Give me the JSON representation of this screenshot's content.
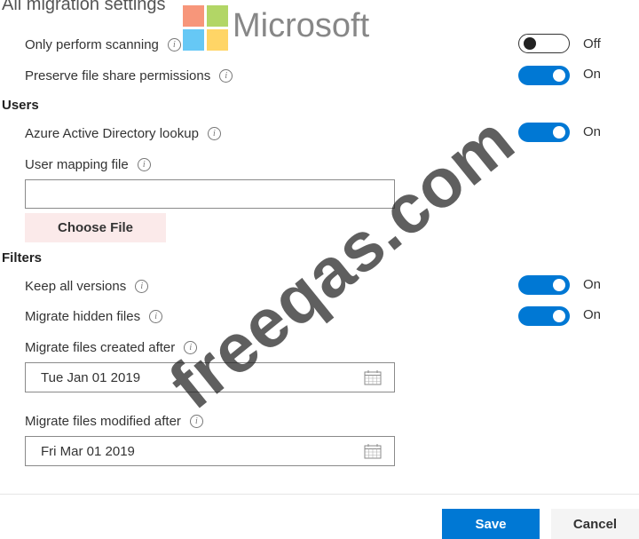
{
  "panel": {
    "title": "All migration settings"
  },
  "brand": {
    "name": "Microsoft",
    "colors": [
      "#f25022",
      "#7fba00",
      "#00a4ef",
      "#ffb900"
    ]
  },
  "settings": {
    "only_scanning": {
      "label": "Only perform scanning",
      "state": "Off",
      "on": false
    },
    "preserve_permissions": {
      "label": "Preserve file share permissions",
      "state": "On",
      "on": true
    }
  },
  "users": {
    "heading": "Users",
    "aad_lookup": {
      "label": "Azure Active Directory lookup",
      "state": "On",
      "on": true
    },
    "mapping_file": {
      "label": "User mapping file",
      "value": "",
      "choose_label": "Choose File"
    }
  },
  "filters": {
    "heading": "Filters",
    "keep_versions": {
      "label": "Keep all versions",
      "state": "On",
      "on": true
    },
    "hidden_files": {
      "label": "Migrate hidden files",
      "state": "On",
      "on": true
    },
    "created_after": {
      "label": "Migrate files created after",
      "value": "Tue Jan 01 2019"
    },
    "modified_after": {
      "label": "Migrate files modified after",
      "value": "Fri Mar 01 2019"
    }
  },
  "footer": {
    "save_label": "Save",
    "cancel_label": "Cancel"
  },
  "watermark": {
    "text": "freeqas.com"
  },
  "icons": {
    "info": "info-icon",
    "calendar": "calendar-icon"
  },
  "colors": {
    "accent": "#0078d4",
    "choose_button_bg": "#fbeaea"
  }
}
